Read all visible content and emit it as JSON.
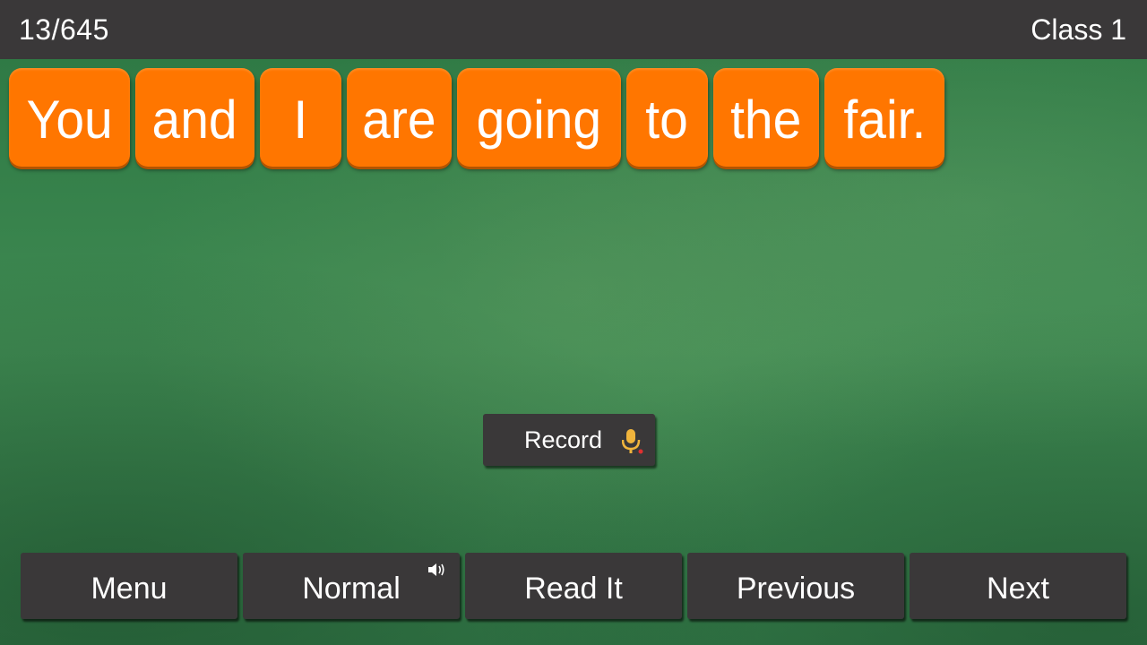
{
  "header": {
    "progress": "13/645",
    "class_label": "Class 1"
  },
  "sentence": {
    "words": [
      "You",
      "and",
      "I",
      "are",
      "going",
      "to",
      "the",
      "fair."
    ],
    "tile_color": "#ff7600"
  },
  "record": {
    "label": "Record",
    "icon": "microphone-icon",
    "icon_color": "#f0b43c",
    "indicator_color": "#e03030"
  },
  "nav": {
    "buttons": [
      {
        "label": "Menu"
      },
      {
        "label": "Normal",
        "icon": "speaker-icon"
      },
      {
        "label": "Read It"
      },
      {
        "label": "Previous"
      },
      {
        "label": "Next"
      }
    ]
  },
  "colors": {
    "bar": "#3a3839",
    "board": "#3b7d4c"
  }
}
